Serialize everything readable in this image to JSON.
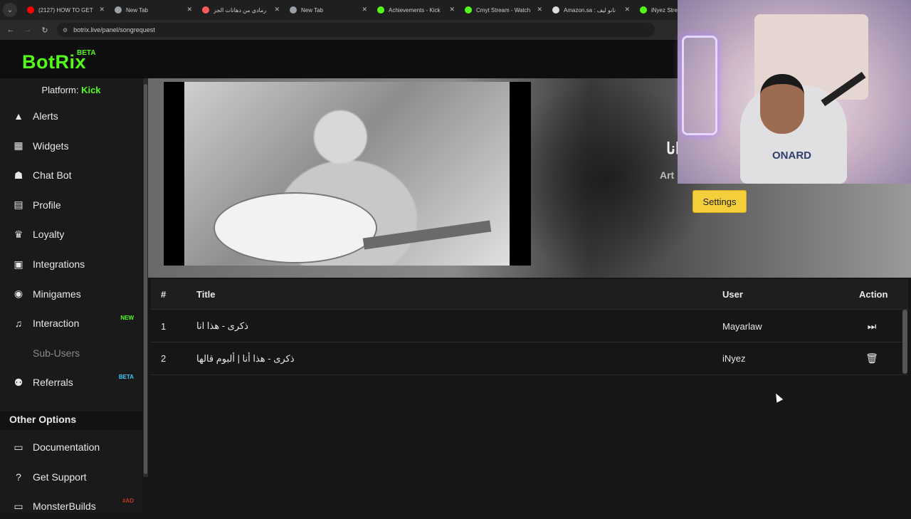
{
  "browser": {
    "tabs": [
      {
        "label": "(2127) HOW TO GET",
        "icon": "youtube-icon",
        "color": "#ff0000"
      },
      {
        "label": "New Tab",
        "icon": "globe-icon",
        "color": "#9aa0a6"
      },
      {
        "label": "رمادي من دهانات الجز",
        "icon": "paint-icon",
        "color": "#ff5a5a"
      },
      {
        "label": "New Tab",
        "icon": "globe-icon",
        "color": "#9aa0a6"
      },
      {
        "label": "Achievements - Kick",
        "icon": "kick-icon",
        "color": "#53fc18"
      },
      {
        "label": "Cmyt Stream - Watch",
        "icon": "kick-icon",
        "color": "#53fc18"
      },
      {
        "label": "Amazon.sa : نانو ليف",
        "icon": "amazon-icon",
        "color": "#dddddd"
      },
      {
        "label": "iNyez Stream",
        "icon": "kick-icon",
        "color": "#53fc18"
      }
    ],
    "url": "botrix.live/panel/songrequest",
    "close_glyph": "✕"
  },
  "app": {
    "logo": "BotRix",
    "logo_badge": "BETA",
    "brand_color": "#53fc18"
  },
  "sidebar": {
    "platform_label": "Platform:",
    "platform_value": "Kick",
    "items": [
      {
        "label": "Alerts",
        "icon": "warning-icon",
        "glyph": "▲"
      },
      {
        "label": "Widgets",
        "icon": "grid-icon",
        "glyph": "▦"
      },
      {
        "label": "Chat Bot",
        "icon": "robot-icon",
        "glyph": "☗"
      },
      {
        "label": "Profile",
        "icon": "id-card-icon",
        "glyph": "▤"
      },
      {
        "label": "Loyalty",
        "icon": "trophy-icon",
        "glyph": "♛"
      },
      {
        "label": "Integrations",
        "icon": "plug-icon",
        "glyph": "▣"
      },
      {
        "label": "Minigames",
        "icon": "gamepad-icon",
        "glyph": "◉"
      },
      {
        "label": "Interaction",
        "icon": "music-icon",
        "glyph": "♫",
        "badge": "NEW",
        "badge_color": "#53fc18"
      },
      {
        "label": "Sub-Users",
        "icon": "users-icon",
        "glyph": "",
        "disabled": true
      },
      {
        "label": "Referrals",
        "icon": "users-icon",
        "glyph": "⚉",
        "badge": "BETA",
        "badge_color": "#3ec7ff"
      }
    ],
    "other_options": "Other Options",
    "other_items": [
      {
        "label": "Documentation",
        "icon": "book-icon",
        "glyph": "▭"
      },
      {
        "label": "Get Support",
        "icon": "question-icon",
        "glyph": "?"
      },
      {
        "label": "MonsterBuilds",
        "icon": "laptop-icon",
        "glyph": "▭",
        "badge": "#AD",
        "badge_color": "#c0392b"
      }
    ]
  },
  "player": {
    "now_title": "انا",
    "now_artist": "Art",
    "settings_label": "Settings"
  },
  "queue": {
    "columns": {
      "num": "#",
      "title": "Title",
      "user": "User",
      "action": "Action"
    },
    "rows": [
      {
        "num": "1",
        "title": "ذكرى - هذا انا",
        "user": "Mayarlaw",
        "action_icon": "skip-icon",
        "action_glyph": "⏭"
      },
      {
        "num": "2",
        "title": "ذكرى - هذا أنا | ألبوم قالها",
        "user": "iNyez",
        "action_icon": "trash-icon",
        "action_glyph": "🗑"
      }
    ]
  },
  "webcam": {
    "shirt_text": "ONARD"
  }
}
